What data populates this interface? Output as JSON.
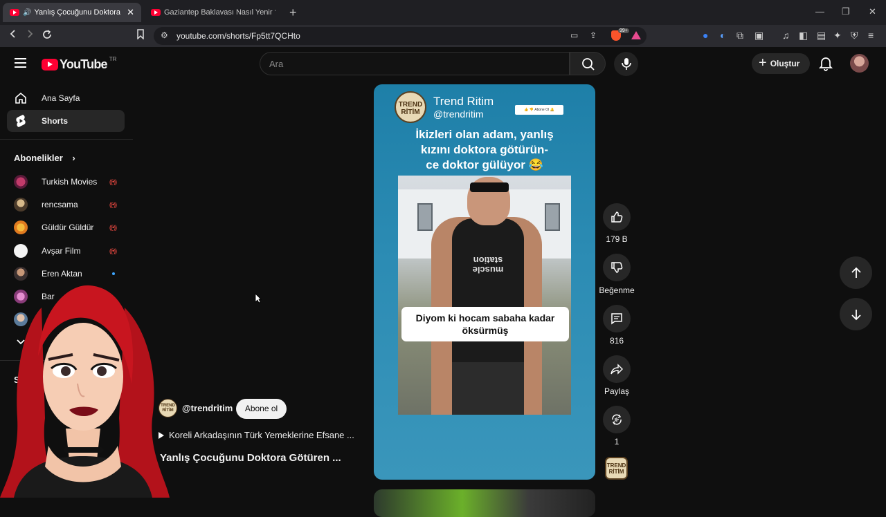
{
  "browser": {
    "tabs": [
      {
        "title": "Yanlış Çocuğunu Doktora Gö",
        "active": true
      },
      {
        "title": "Gaziantep Baklavası Nasıl Yenir ? - Ke",
        "active": false
      }
    ],
    "url": "youtube.com/shorts/Fp5tt7QCHto",
    "brave_badge": "99+"
  },
  "header": {
    "logo_text": "YouTube",
    "country_code": "TR",
    "search_placeholder": "Ara",
    "create_label": "Oluştur"
  },
  "sidebar": {
    "items": [
      {
        "label": "Ana Sayfa"
      },
      {
        "label": "Shorts"
      }
    ],
    "subscriptions_label": "Abonelikler",
    "subscriptions": [
      {
        "name": "Turkish Movies",
        "status": "live"
      },
      {
        "name": "rencsama",
        "status": "live"
      },
      {
        "name": "Güldür Güldür",
        "status": "live"
      },
      {
        "name": "Avşar Film",
        "status": "live"
      },
      {
        "name": "Eren Aktan",
        "status": "new"
      },
      {
        "name": "Bar",
        "status": ""
      }
    ],
    "you_label": "Siz"
  },
  "video": {
    "channel_name": "Trend Ritim",
    "channel_handle_overlay": "@trendritim",
    "logo_text_1": "TREND",
    "logo_text_2": "RİTİM",
    "subscribe_graphic": "Abone Ol",
    "overlay_title_1": "İkizleri olan adam, yanlış",
    "overlay_title_2": "kızını doktora götürün-",
    "overlay_title_3": "ce doktor gülüyor 😂",
    "shirt_text_1": "muscle",
    "shirt_text_2": "station",
    "caption_1": "Diyom ki hocam sabaha kadar",
    "caption_2": "öksürmüş"
  },
  "actions": {
    "likes": "179 B",
    "dislike_label": "Beğenme",
    "comments": "816",
    "share_label": "Paylaş",
    "remix": "1"
  },
  "channel": {
    "handle": "@trendritim",
    "subscribe_label": "Abone ol",
    "suggested": "Koreli Arkadaşının Türk Yemeklerine Efsane ...",
    "title": "Yanlış Çocuğunu Doktora Götüren ..."
  },
  "colors": {
    "accent_red": "#ff0033",
    "video_bg": "#1e7fa8",
    "live_red": "#ff4e45"
  }
}
